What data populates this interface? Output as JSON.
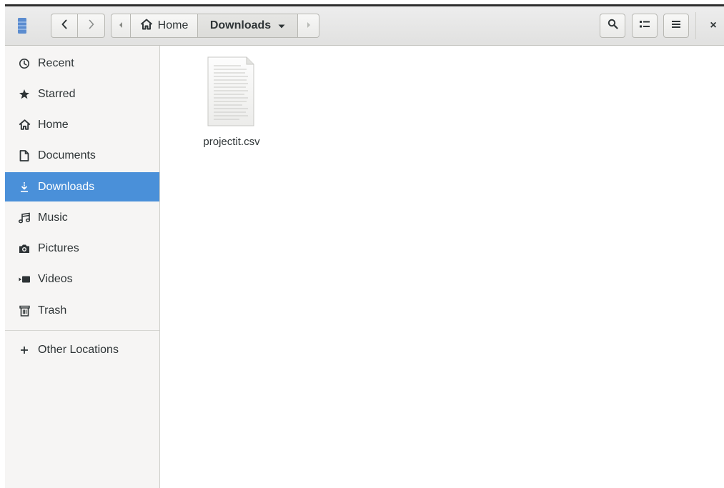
{
  "window": {
    "accent_color": "#4a90d9"
  },
  "headerbar": {
    "app_icon": "files-app-icon",
    "back_icon": "chevron-left-icon",
    "forward_icon": "chevron-right-icon",
    "path_left_icon": "triangle-left-icon",
    "path": [
      {
        "label": "Home",
        "icon": "home-icon"
      },
      {
        "label": "Downloads",
        "icon": "caret-down-icon",
        "selected": true
      }
    ],
    "path_right_icon": "triangle-right-icon",
    "search_icon": "search-icon",
    "view_icon": "grid-view-icon",
    "menu_icon": "hamburger-menu-icon",
    "close_label": "×"
  },
  "sidebar": {
    "items": [
      {
        "label": "Recent",
        "icon": "clock-icon"
      },
      {
        "label": "Starred",
        "icon": "star-icon"
      },
      {
        "label": "Home",
        "icon": "home-icon"
      },
      {
        "label": "Documents",
        "icon": "document-icon"
      },
      {
        "label": "Downloads",
        "icon": "download-icon",
        "active": true
      },
      {
        "label": "Music",
        "icon": "music-note-icon"
      },
      {
        "label": "Pictures",
        "icon": "camera-icon"
      },
      {
        "label": "Videos",
        "icon": "video-icon"
      },
      {
        "label": "Trash",
        "icon": "trash-icon"
      }
    ],
    "other_locations": {
      "label": "Other Locations",
      "icon": "plus-icon"
    }
  },
  "files": [
    {
      "name": "projectit.csv",
      "icon": "text-file-icon"
    }
  ]
}
